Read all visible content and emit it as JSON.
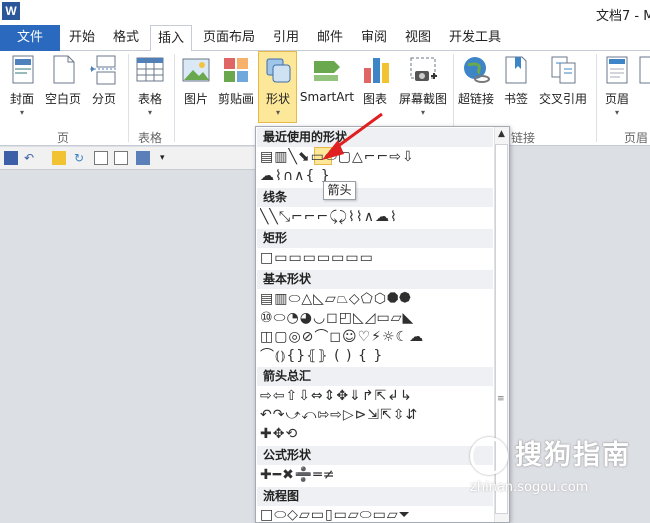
{
  "window": {
    "app_icon_letter": "W",
    "title": "文档7 - M"
  },
  "tabs": [
    {
      "label": "文件"
    },
    {
      "label": "开始"
    },
    {
      "label": "格式"
    },
    {
      "label": "插入"
    },
    {
      "label": "页面布局"
    },
    {
      "label": "引用"
    },
    {
      "label": "邮件"
    },
    {
      "label": "审阅"
    },
    {
      "label": "视图"
    },
    {
      "label": "开发工具"
    }
  ],
  "ribbon": {
    "buttons": [
      {
        "label": "封面"
      },
      {
        "label": "空白页"
      },
      {
        "label": "分页"
      },
      {
        "label": "表格"
      },
      {
        "label": "图片"
      },
      {
        "label": "剪贴画"
      },
      {
        "label": "形状"
      },
      {
        "label": "SmartArt"
      },
      {
        "label": "图表"
      },
      {
        "label": "屏幕截图"
      },
      {
        "label": "超链接"
      },
      {
        "label": "书签"
      },
      {
        "label": "交叉引用"
      },
      {
        "label": "页眉"
      }
    ],
    "groups": [
      {
        "label": "页"
      },
      {
        "label": "表格"
      },
      {
        "label": "链接"
      },
      {
        "label": "页眉"
      }
    ]
  },
  "gallery": {
    "categories": [
      {
        "label": "最近使用的形状"
      },
      {
        "label": "线条"
      },
      {
        "label": "矩形"
      },
      {
        "label": "基本形状"
      },
      {
        "label": "箭头总汇"
      },
      {
        "label": "公式形状"
      },
      {
        "label": "流程图"
      }
    ],
    "rows": [
      "▤▥╲⬊▭⬭▢△⌐⌐⇨⇩",
      "☁⌇∩∧{ }",
      "╲╲⤡⌐⌐⌐⤹⤸⌇⌇∧☁⌇",
      "□▭▭▭▭▭▭▭",
      "▤▥⬭△◺▱⏢◇⬠⬡⯃⯄",
      "⑩⬭◔◕◡◻◰◺◿▭▱◣",
      "◫▢◎⊘⌒◻☺♡⚡☼☾☁",
      "⌒⦅⦆{}⦃⦄ ( ) { }",
      "⇨⇦⇧⇩⇔⇕✥⇓↱⇱↲↳",
      "↶↷⤻⤺⇰⇨▷⊳⇲⇱⇳⇵",
      "✚✥⟲",
      "✚━✖➗═≠",
      "□⬭◇▱▭▯▭▱⬭▭▱⏷"
    ],
    "tooltip": "箭头"
  },
  "watermark": {
    "text": "搜狗指南",
    "url": "zhinan.sogou.com"
  },
  "colors": {
    "file_tab": "#2a69be",
    "highlight": "#fde89a",
    "annotation_arrow": "#e02020"
  }
}
